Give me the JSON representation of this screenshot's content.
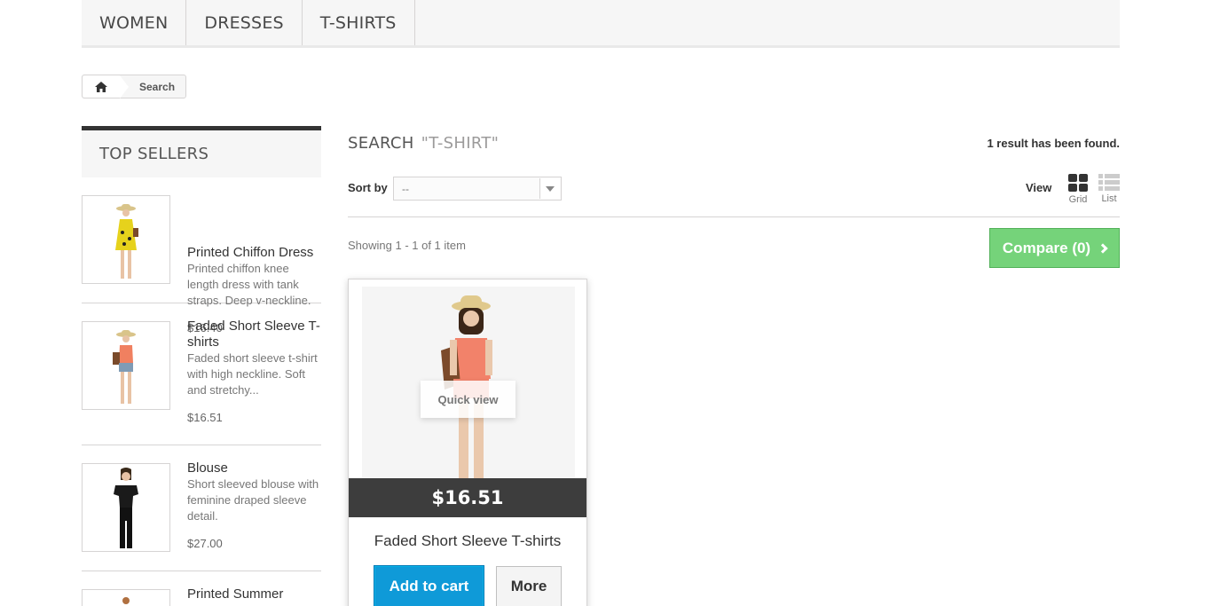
{
  "topmenu": {
    "items": [
      "WOMEN",
      "DRESSES",
      "T-SHIRTS"
    ]
  },
  "breadcrumb": {
    "home_icon": "home-icon",
    "current": "Search"
  },
  "sidebar": {
    "title": "TOP SELLERS",
    "items": [
      {
        "name": "Printed Chiffon Dress",
        "desc": "Printed chiffon knee length dress with tank straps. Deep v-neckline.",
        "price": "$16.40"
      },
      {
        "name": "Faded Short Sleeve T-shirts",
        "desc": "Faded short sleeve t-shirt with high neckline. Soft and stretchy...",
        "price": "$16.51"
      },
      {
        "name": "Blouse",
        "desc": "Short sleeved blouse with feminine draped sleeve detail.",
        "price": "$27.00"
      },
      {
        "name": "Printed Summer"
      }
    ]
  },
  "main": {
    "title": "SEARCH",
    "query": "\"T-SHIRT\"",
    "result_count": "1 result has been found.",
    "sort_label": "Sort by",
    "sort_value": "--",
    "view_label": "View",
    "view_grid": "Grid",
    "view_list": "List",
    "showing": "Showing 1 - 1 of 1 item",
    "compare": "Compare (0)",
    "product": {
      "quick_view": "Quick view",
      "price": "$16.51",
      "name": "Faded Short Sleeve T-shirts",
      "add_to_cart": "Add to cart",
      "more": "More"
    }
  },
  "colors": {
    "compare_green": "#75d37a",
    "cart_blue": "#0f9ad8",
    "price_bar": "#282828"
  }
}
